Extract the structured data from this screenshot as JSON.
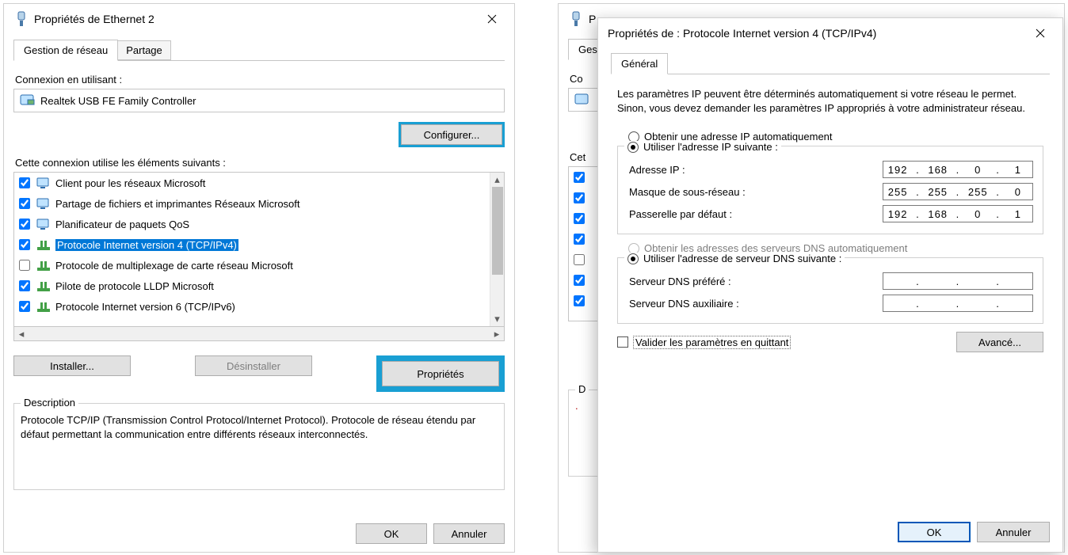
{
  "ethernet": {
    "title": "Propriétés de Ethernet 2",
    "tabs": {
      "network": "Gestion de réseau",
      "sharing": "Partage"
    },
    "connect_using_label": "Connexion en utilisant :",
    "adapter": "Realtek USB FE Family Controller",
    "configure_btn": "Configurer...",
    "components_label": "Cette connexion utilise les éléments suivants :",
    "items": [
      {
        "label": "Client pour les réseaux Microsoft",
        "checked": true,
        "type": "net"
      },
      {
        "label": "Partage de fichiers et imprimantes Réseaux Microsoft",
        "checked": true,
        "type": "net"
      },
      {
        "label": "Planificateur de paquets QoS",
        "checked": true,
        "type": "net"
      },
      {
        "label": "Protocole Internet version 4 (TCP/IPv4)",
        "checked": true,
        "type": "proto",
        "selected": true
      },
      {
        "label": "Protocole de multiplexage de carte réseau Microsoft",
        "checked": false,
        "type": "proto"
      },
      {
        "label": "Pilote de protocole LLDP Microsoft",
        "checked": true,
        "type": "proto"
      },
      {
        "label": "Protocole Internet version 6 (TCP/IPv6)",
        "checked": true,
        "type": "proto"
      }
    ],
    "install_btn": "Installer...",
    "uninstall_btn": "Désinstaller",
    "properties_btn": "Propriétés",
    "description_legend": "Description",
    "description_text": "Protocole TCP/IP (Transmission Control Protocol/Internet Protocol). Protocole de réseau étendu par défaut permettant la communication entre différents réseaux interconnectés.",
    "ok_btn": "OK",
    "cancel_btn": "Annuler"
  },
  "winbg": {
    "title_prefix": "P",
    "tab_prefix": "Gest",
    "connect_prefix": "Co",
    "components_prefix": "Cet",
    "desc_prefix": "D"
  },
  "ipv4": {
    "title": "Propriétés de : Protocole Internet version 4 (TCP/IPv4)",
    "tab": "Général",
    "intro": "Les paramètres IP peuvent être déterminés automatiquement si votre réseau le permet. Sinon, vous devez demander les paramètres IP appropriés à votre administrateur réseau.",
    "ip_auto": "Obtenir une adresse IP automatiquement",
    "ip_manual": "Utiliser l'adresse IP suivante :",
    "addr_label": "Adresse IP :",
    "addr_value": [
      "192",
      "168",
      "0",
      "1"
    ],
    "mask_label": "Masque de sous-réseau :",
    "mask_value": [
      "255",
      "255",
      "255",
      "0"
    ],
    "gw_label": "Passerelle par défaut :",
    "gw_value": [
      "192",
      "168",
      "0",
      "1"
    ],
    "dns_auto": "Obtenir les adresses des serveurs DNS automatiquement",
    "dns_manual": "Utiliser l'adresse de serveur DNS suivante :",
    "dns_pref_label": "Serveur DNS préféré :",
    "dns_pref_value": [
      "",
      "",
      "",
      ""
    ],
    "dns_alt_label": "Serveur DNS auxiliaire :",
    "dns_alt_value": [
      "",
      "",
      "",
      ""
    ],
    "validate_label": "Valider les paramètres en quittant",
    "advanced_btn": "Avancé...",
    "ok_btn": "OK",
    "cancel_btn": "Annuler"
  }
}
